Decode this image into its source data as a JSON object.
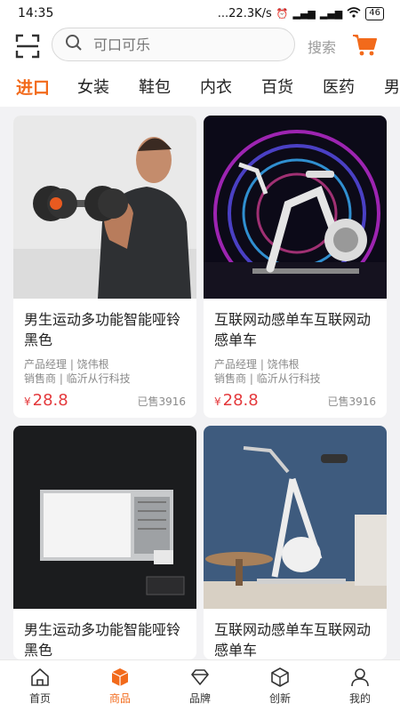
{
  "status_bar": {
    "time": "14:35",
    "network_speed": "...22.3K/s",
    "battery": "46"
  },
  "search": {
    "placeholder": "可口可乐",
    "value": "",
    "search_label": "搜索"
  },
  "categories": [
    "进口",
    "女装",
    "鞋包",
    "内衣",
    "百货",
    "医药",
    "男"
  ],
  "active_category": "进口",
  "products": [
    {
      "title": "男生运动多功能智能哑铃黑色",
      "manager": "产品经理 | 饶伟根",
      "seller": "销售商 | 临沂从行科技",
      "currency": "¥",
      "price": "28.8",
      "sold": "已售3916",
      "image": "dumbbell-man"
    },
    {
      "title": "互联网动感单车互联网动感单车",
      "manager": "产品经理 | 饶伟根",
      "seller": "销售商 | 临沂从行科技",
      "currency": "¥",
      "price": "28.8",
      "sold": "已售3916",
      "image": "spin-bike-neon"
    },
    {
      "title": "男生运动多功能智能哑铃黑色",
      "manager": "",
      "seller": "",
      "currency": "",
      "price": "",
      "sold": "",
      "image": "bath-heater-panel"
    },
    {
      "title": "互联网动感单车互联网动感单车",
      "manager": "",
      "seller": "",
      "currency": "",
      "price": "",
      "sold": "",
      "image": "exercise-bike-room"
    }
  ],
  "bottom_nav": [
    {
      "label": "首页",
      "icon": "home-icon",
      "active": false
    },
    {
      "label": "商品",
      "icon": "box-icon",
      "active": true
    },
    {
      "label": "品牌",
      "icon": "diamond-icon",
      "active": false
    },
    {
      "label": "创新",
      "icon": "cube-icon",
      "active": false
    },
    {
      "label": "我的",
      "icon": "person-icon",
      "active": false
    }
  ],
  "colors": {
    "accent": "#f26a1b",
    "price": "#e4393c",
    "background": "#f2f2f4"
  }
}
